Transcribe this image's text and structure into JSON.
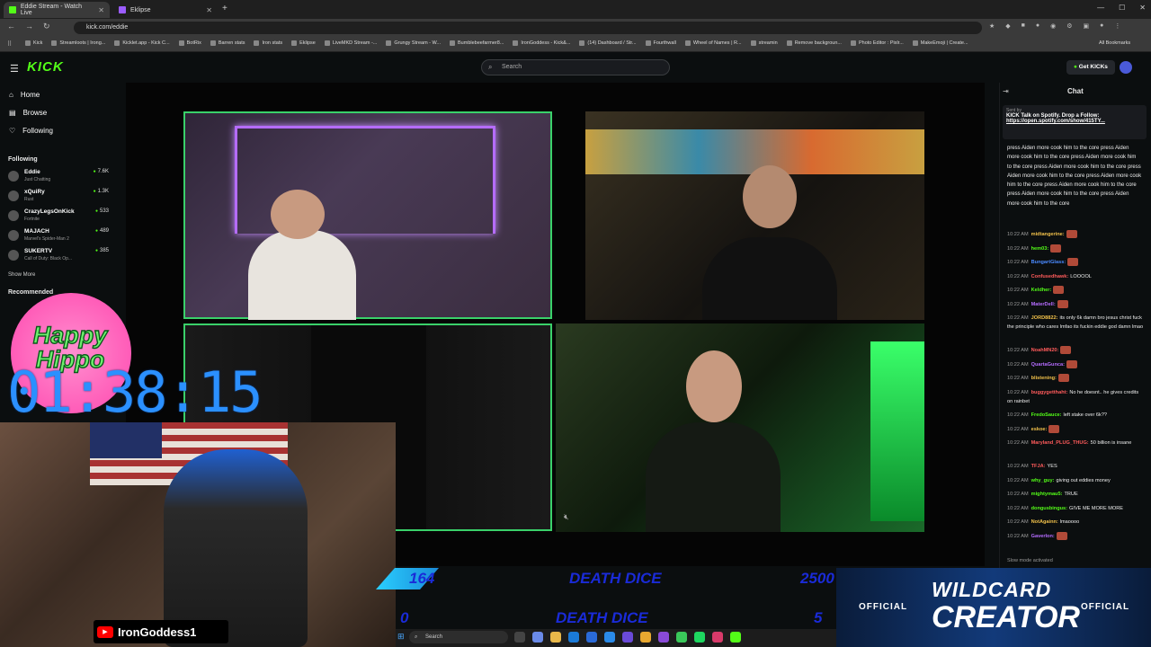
{
  "browser": {
    "tabs": [
      {
        "title": "Eddie Stream - Watch Live"
      },
      {
        "title": "Eklipse"
      }
    ],
    "url": "kick.com/eddie",
    "bookmarks": [
      "Kick",
      "Streamloots | Irong...",
      "Kicklet.app - Kick C...",
      "BotRix",
      "Barren stats",
      "Iron stats",
      "Eklipse",
      "LiveMKD Stream -...",
      "Grungy Stream - W...",
      "Bumblebeefarmer8...",
      "IronGoddess - Kick&...",
      "(14) Dashboard / Str...",
      "Fourthwall",
      "Wheel of Names | R...",
      "streamin",
      "Remove backgroun...",
      "Photo Editor : Pixlr...",
      "MakeEmoji | Create..."
    ],
    "all_bookmarks": "All Bookmarks"
  },
  "header": {
    "logo": "KICK",
    "search_placeholder": "Search",
    "get_kicks": "Get KICKs"
  },
  "sidebar": {
    "nav": [
      {
        "label": "Home"
      },
      {
        "label": "Browse"
      },
      {
        "label": "Following"
      }
    ],
    "following_title": "Following",
    "following": [
      {
        "name": "Eddie",
        "game": "Just Chatting",
        "viewers": "7.6K"
      },
      {
        "name": "xQuiRy",
        "game": "Rust",
        "viewers": "1.3K"
      },
      {
        "name": "CrazyLegsOnKick",
        "game": "Fortnite",
        "viewers": "533"
      },
      {
        "name": "MAJACH",
        "game": "Marvel's Spider-Man 2",
        "viewers": "489"
      },
      {
        "name": "SUKERTV",
        "game": "Call of Duty: Black Op...",
        "viewers": "385"
      }
    ],
    "show_more": "Show More",
    "recommended_title": "Recommended"
  },
  "chat": {
    "title": "Chat",
    "pinned": {
      "sent_by": "Sent by",
      "message": "KICK Talk on Spotify. Drop a Follow:",
      "link": "https://open.spotify.com/show/415TY..."
    },
    "spam": "press Aiden more cook him to the core press Aiden more cook him to the core press Aiden more cook him to the core press Aiden more cook him to the core press Aiden more cook him to the core press Aiden more cook him to the core press Aiden more cook him to the core press Aiden more cook him to the core press Aiden more cook him to the core",
    "messages": [
      {
        "time": "10:22 AM",
        "user": "midtangerine:",
        "color": "#f0c04a",
        "text": ""
      },
      {
        "time": "10:22 AM",
        "user": "hem03:",
        "color": "#53fc18",
        "text": ""
      },
      {
        "time": "10:22 AM",
        "user": "BungartGlass:",
        "color": "#4a8aff",
        "text": ""
      },
      {
        "time": "10:22 AM",
        "user": "Confusedhawk:",
        "color": "#ff5b5b",
        "text": "LOOOOL"
      },
      {
        "time": "10:22 AM",
        "user": "Keldher:",
        "color": "#53fc18",
        "text": ""
      },
      {
        "time": "10:22 AM",
        "user": "MaterDell:",
        "color": "#b56cff",
        "text": ""
      },
      {
        "time": "10:22 AM",
        "user": "JORD8822:",
        "color": "#f0c04a",
        "text": "its only 6k damn bro jesus christ fuck the principle who cares lmfao its fuckin eddie god damn lmao"
      },
      {
        "time": "10:22 AM",
        "user": "NoahMN20:",
        "color": "#ff5b5b",
        "text": ""
      },
      {
        "time": "10:22 AM",
        "user": "QuartaGunca:",
        "color": "#b56cff",
        "text": ""
      },
      {
        "time": "10:22 AM",
        "user": "blistening:",
        "color": "#f0c04a",
        "text": ""
      },
      {
        "time": "10:22 AM",
        "user": "buggygetthaht:",
        "color": "#ff5b5b",
        "text": "No he doesnt.. he gives credits on rainbet"
      },
      {
        "time": "10:22 AM",
        "user": "FredoSauce:",
        "color": "#53fc18",
        "text": "left stake over 6k??"
      },
      {
        "time": "10:22 AM",
        "user": "eskoe:",
        "color": "#f0c04a",
        "text": ""
      },
      {
        "time": "10:22 AM",
        "user": "Maryland_PLUG_THUG:",
        "color": "#ff5b5b",
        "text": "50 billion is insane"
      },
      {
        "time": "10:22 AM",
        "user": "TFJA:",
        "color": "#ff5b5b",
        "text": "YES"
      },
      {
        "time": "10:22 AM",
        "user": "why_guy:",
        "color": "#53fc18",
        "text": "giving out eddies money"
      },
      {
        "time": "10:22 AM",
        "user": "mightymau5:",
        "color": "#53fc18",
        "text": "TRUE"
      },
      {
        "time": "10:22 AM",
        "user": "dongusbingus:",
        "color": "#53fc18",
        "text": "GIVE ME MORE MORE"
      },
      {
        "time": "10:22 AM",
        "user": "NotAgainn:",
        "color": "#f0c04a",
        "text": "lmaoooo"
      },
      {
        "time": "10:22 AM",
        "user": "Gaverlon:",
        "color": "#b56cff",
        "text": ""
      }
    ],
    "slow_mode": "Slow mode activated"
  },
  "overlay": {
    "hippo_line1": "Happy",
    "hippo_line2": "Hippo",
    "timer": "01:38:15",
    "youtube_name": "IronGoddess1",
    "death_dice": [
      {
        "left": "164",
        "label": "DEATH DICE",
        "right": "2500"
      },
      {
        "left": "0",
        "label": "DEATH DICE",
        "right": "5"
      }
    ],
    "wildcard_left": "OFFICIAL",
    "wildcard_right": "OFFICIAL",
    "wildcard_title1": "WILDCARD",
    "wildcard_title2": "CREATOR"
  },
  "taskbar": {
    "search": "Search"
  }
}
